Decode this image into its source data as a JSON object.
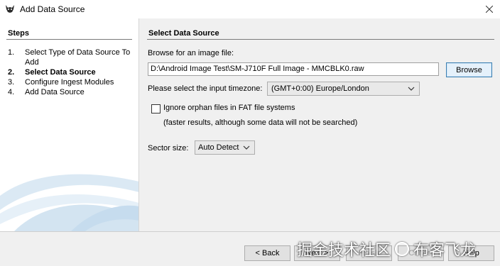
{
  "window": {
    "title": "Add Data Source",
    "icon": "autopsy-dog-icon"
  },
  "steps": {
    "header": "Steps",
    "items": [
      {
        "num": "1.",
        "label": "Select Type of Data Source To Add"
      },
      {
        "num": "2.",
        "label": "Select Data Source"
      },
      {
        "num": "3.",
        "label": "Configure Ingest Modules"
      },
      {
        "num": "4.",
        "label": "Add Data Source"
      }
    ],
    "active_index": 1
  },
  "main": {
    "header": "Select Data Source",
    "browse_label": "Browse for an image file:",
    "path_value": "D:\\Android Image Test\\SM-J710F Full Image - MMCBLK0.raw",
    "browse_button": "Browse",
    "timezone_label": "Please select the input timezone:",
    "timezone_value": "(GMT+0:00) Europe/London",
    "ignore_orphan_label": "Ignore orphan files in FAT file systems",
    "ignore_orphan_checked": false,
    "ignore_orphan_note": "(faster results, although some data will not be searched)",
    "sector_label": "Sector size:",
    "sector_value": "Auto Detect"
  },
  "footer": {
    "back": "< Back",
    "next": "Next >",
    "finish": "Finish",
    "cancel": "Cancel",
    "help": "Help"
  },
  "watermark": {
    "text_left": "掘金技术社区",
    "text_right": "布客飞龙"
  },
  "colors": {
    "accent_border": "#3c7fb1",
    "accent_bg": "#e5f1fb"
  }
}
